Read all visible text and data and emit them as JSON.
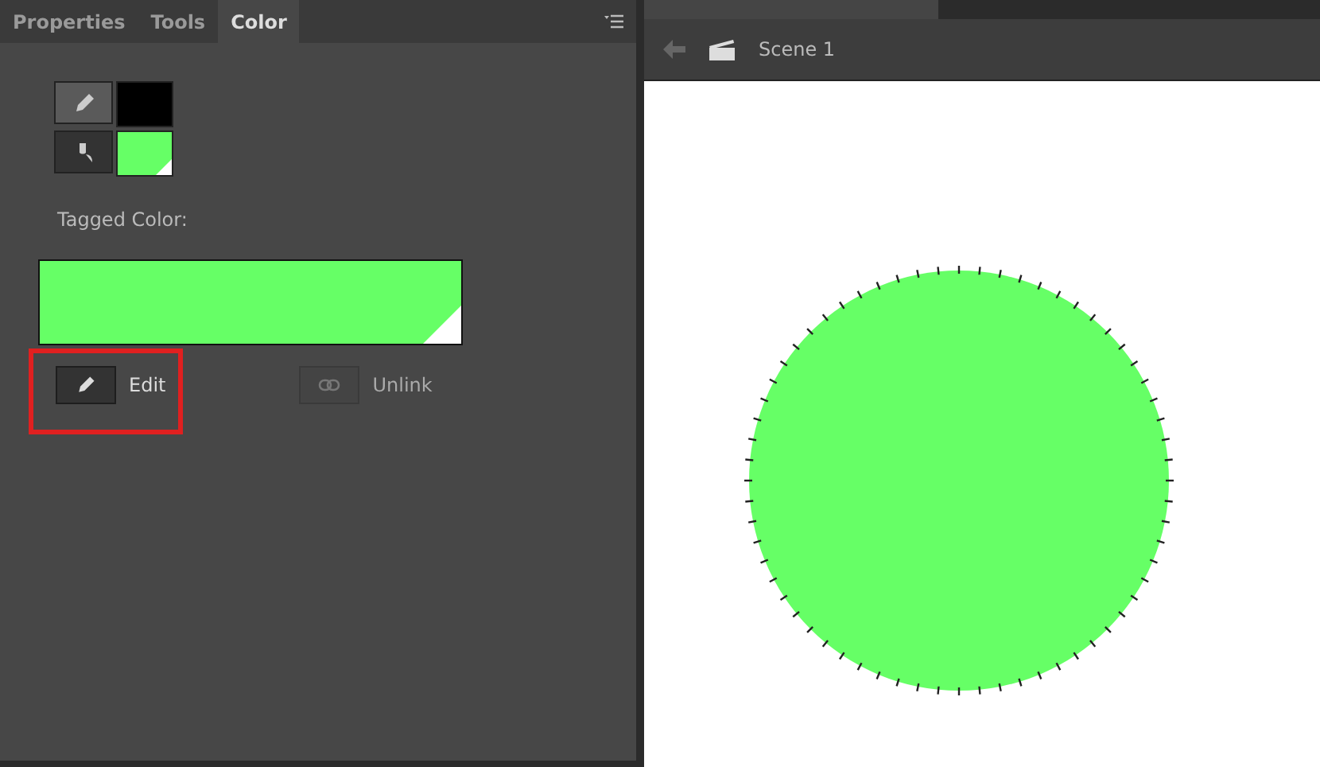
{
  "panel": {
    "tabs": [
      {
        "label": "Properties",
        "selected": false
      },
      {
        "label": "Tools",
        "selected": false
      },
      {
        "label": "Color",
        "selected": true
      }
    ],
    "stroke": {
      "color": "#000000"
    },
    "fill": {
      "color": "#66ff66"
    },
    "tagged_label": "Tagged Color:",
    "tagged_swatch": {
      "color": "#66ff66"
    },
    "buttons": [
      {
        "kind": "edit",
        "label": "Edit",
        "disabled": false,
        "highlighted": true
      },
      {
        "kind": "unlink",
        "label": "Unlink",
        "disabled": true,
        "highlighted": false
      }
    ]
  },
  "stage": {
    "scene": "Scene 1",
    "shape": {
      "color": "#66ff66"
    }
  }
}
